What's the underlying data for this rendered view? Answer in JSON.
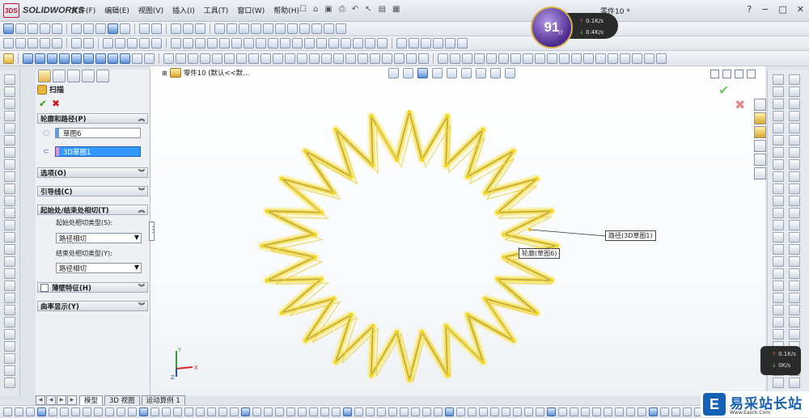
{
  "app": {
    "brand": "SOLIDWORKS",
    "brand_prefix": "3DS",
    "window_title": "零件10 *",
    "menu": [
      "文件(F)",
      "编辑(E)",
      "视图(V)",
      "插入(I)",
      "工具(T)",
      "窗口(W)",
      "帮助(H)"
    ],
    "window_controls": [
      "?",
      "−",
      "□",
      "✕"
    ]
  },
  "speed_badge": {
    "score": "91",
    "score_unit": "分",
    "upload": "0.1K/s",
    "download": "0.4K/s",
    "mini_upload": "0.1K/s",
    "mini_download": "0K/s"
  },
  "property_manager": {
    "feature_title": "扫描",
    "ok_symbol": "✔",
    "cancel_symbol": "✖",
    "sections": {
      "profile_path": "轮廓和路径(P)",
      "options": "选项(O)",
      "guide_curves": "引导线(C)",
      "tangency": "起始处/结束处相切(T)",
      "thin_feature": "薄壁特征(H)",
      "curvature_display": "曲率显示(Y)"
    },
    "profile_selection": "草图6",
    "path_selection": "3D草图1",
    "start_tangency_label": "起始处相切类型(S):",
    "start_tangency_value": "路径相切",
    "end_tangency_label": "结束处相切类型(Y):",
    "end_tangency_value": "路径相切"
  },
  "viewport": {
    "breadcrumb": "零件10 (默认<<默...",
    "callout_path": "路径(3D草图1)",
    "callout_profile": "轮廓(草图6)",
    "ok_symbol": "✔",
    "cancel_symbol": "✖",
    "axis_x": "X",
    "axis_y": "Y",
    "axis_z": "Z"
  },
  "bottom_tabs": [
    "模型",
    "3D 视图",
    "运动算例 1"
  ],
  "watermark": {
    "logo_letter": "E",
    "name": "易采站长站",
    "url": "Www.Easck.Com"
  },
  "colors": {
    "accent_blue": "#3399ff",
    "spring_yellow": "#f5e15a",
    "ok_green": "#2e9b1c",
    "cancel_red": "#d01818"
  }
}
